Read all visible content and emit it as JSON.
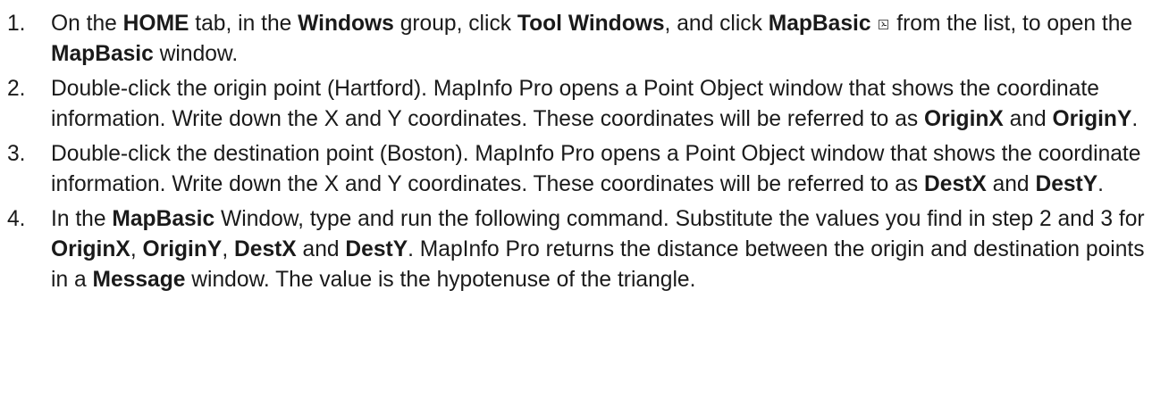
{
  "steps": [
    {
      "number": "1.",
      "parts": [
        {
          "t": "On the "
        },
        {
          "t": "HOME",
          "b": true
        },
        {
          "t": " tab, in the "
        },
        {
          "t": "Windows",
          "b": true
        },
        {
          "t": " group, click "
        },
        {
          "t": "Tool Windows",
          "b": true
        },
        {
          "t": ", and click "
        },
        {
          "t": "MapBasic",
          "b": true
        },
        {
          "t": " "
        },
        {
          "icon": "mapbasic-window-icon"
        },
        {
          "t": " from the list, to open the "
        },
        {
          "t": "MapBasic",
          "b": true
        },
        {
          "t": " window."
        }
      ]
    },
    {
      "number": "2.",
      "parts": [
        {
          "t": "Double-click the origin point (Hartford). MapInfo Pro opens a Point Object window that shows the coordinate information. Write down the X and Y coordinates. These coordinates will be referred to as "
        },
        {
          "t": "OriginX",
          "b": true
        },
        {
          "t": " and "
        },
        {
          "t": "OriginY",
          "b": true
        },
        {
          "t": "."
        }
      ]
    },
    {
      "number": "3.",
      "parts": [
        {
          "t": "Double-click the destination point (Boston). MapInfo Pro opens a Point Object window that shows the coordinate information. Write down the X and Y coordinates. These coordinates will be referred to as "
        },
        {
          "t": "DestX",
          "b": true
        },
        {
          "t": " and "
        },
        {
          "t": "DestY",
          "b": true
        },
        {
          "t": "."
        }
      ]
    },
    {
      "number": "4.",
      "parts": [
        {
          "t": "In the "
        },
        {
          "t": "MapBasic",
          "b": true
        },
        {
          "t": " Window, type and run the following command. Substitute the values you find in step 2 and 3 for "
        },
        {
          "t": "OriginX",
          "b": true
        },
        {
          "t": ", "
        },
        {
          "t": "OriginY",
          "b": true
        },
        {
          "t": ", "
        },
        {
          "t": "DestX",
          "b": true
        },
        {
          "t": " and "
        },
        {
          "t": "DestY",
          "b": true
        },
        {
          "t": ". MapInfo Pro returns the distance between the origin and destination points in a "
        },
        {
          "t": "Message",
          "b": true
        },
        {
          "t": " window. The value is the hypotenuse of the triangle."
        }
      ]
    }
  ]
}
